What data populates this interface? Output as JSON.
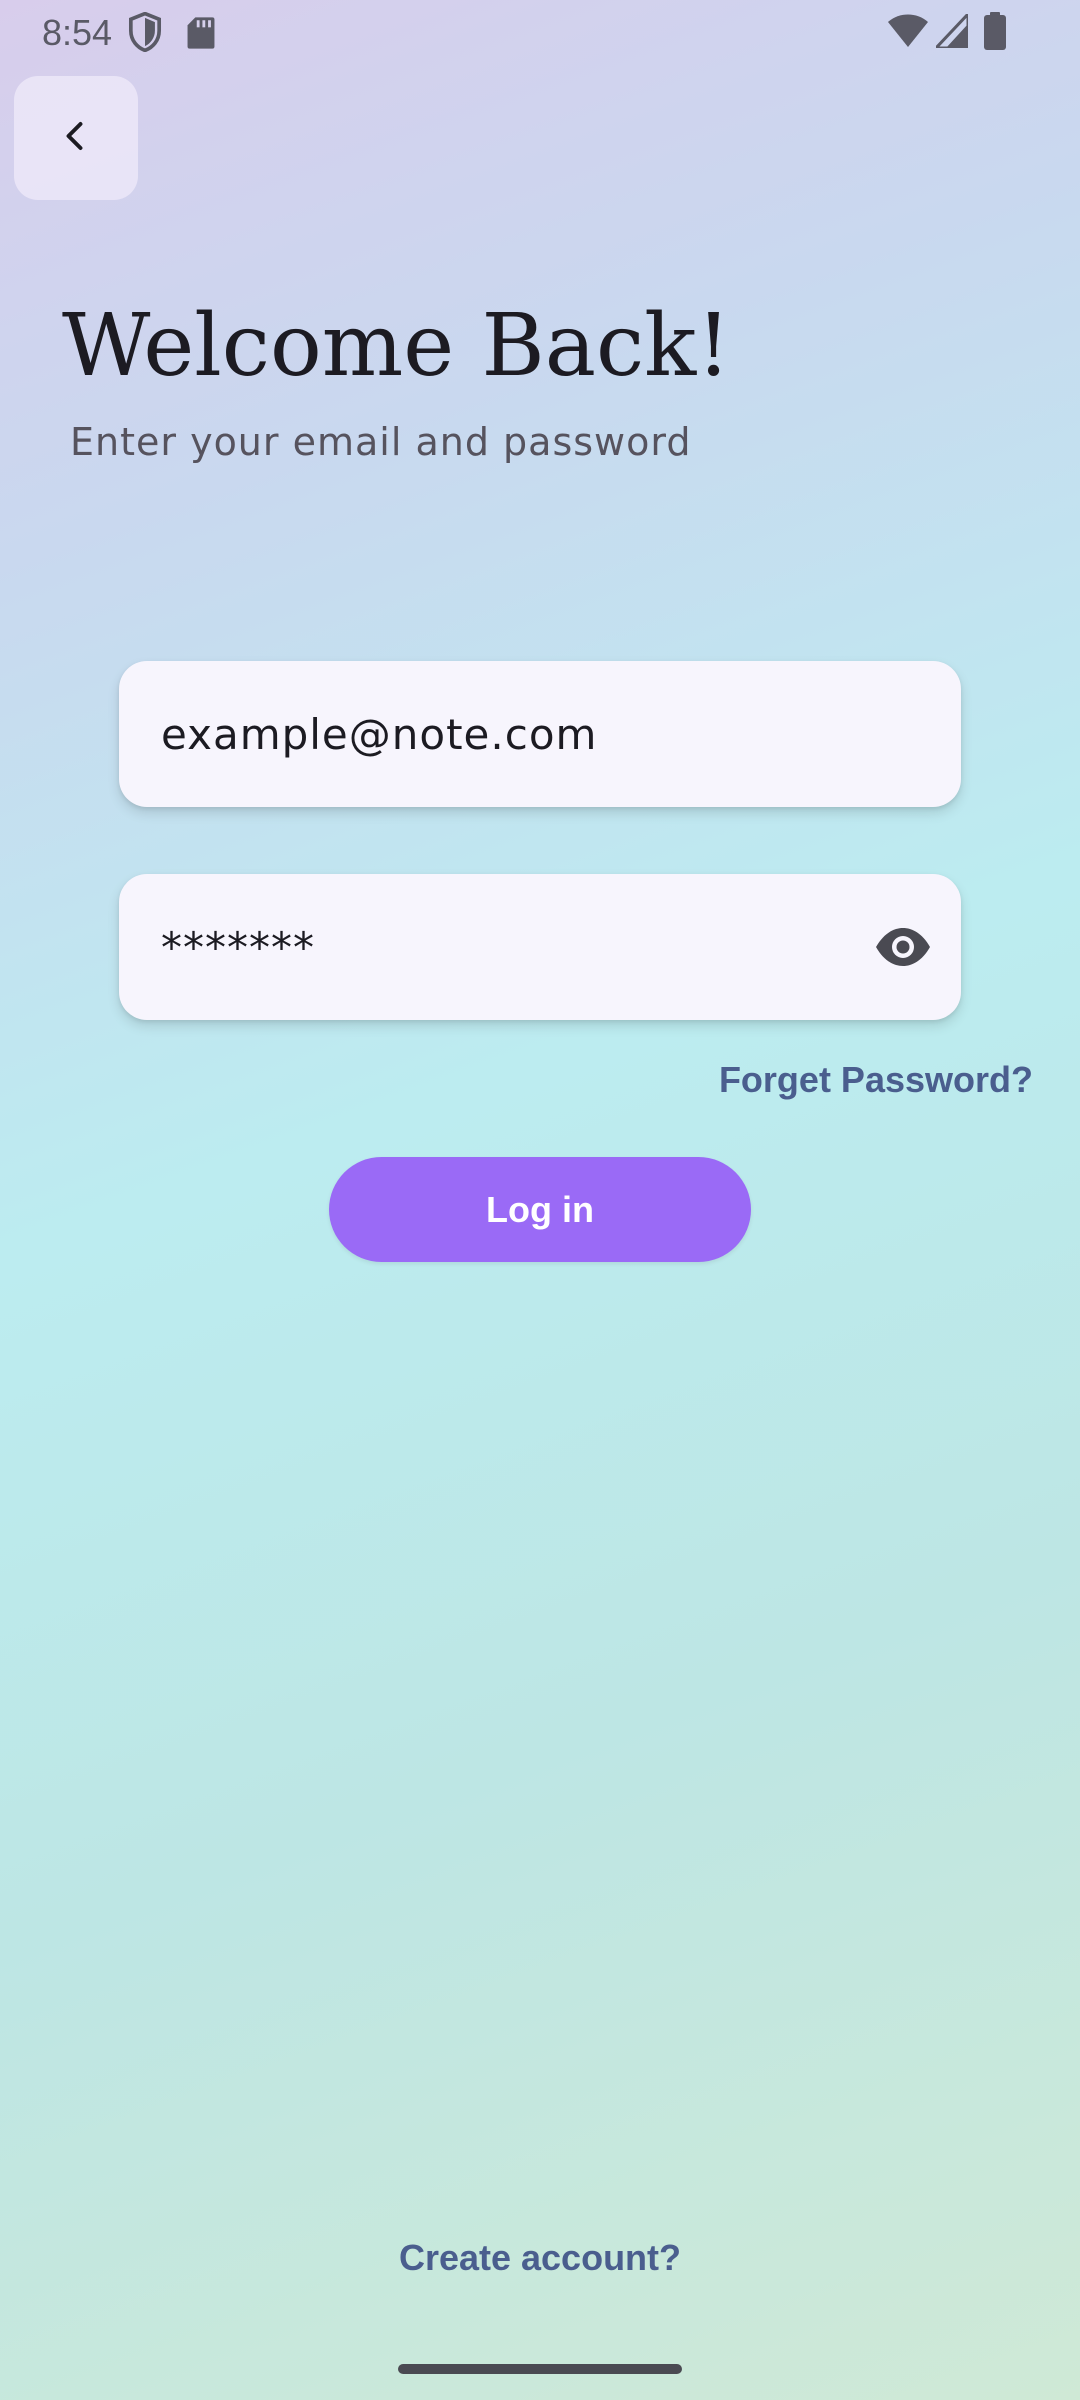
{
  "status_bar": {
    "time": "8:54",
    "left_icons": [
      "shield-icon",
      "sd-card-icon"
    ],
    "right_icons": [
      "wifi-icon",
      "cellular-signal-icon",
      "battery-icon"
    ]
  },
  "header": {
    "back_icon": "chevron-left-icon",
    "title": "Welcome Back!",
    "subtitle": "Enter your email and password"
  },
  "form": {
    "email_value": "example@note.com",
    "password_value": "*******",
    "password_toggle_icon": "eye-icon",
    "forgot_label": "Forget Password?",
    "login_label": "Log in"
  },
  "footer": {
    "create_account_label": "Create account?"
  },
  "colors": {
    "accent": "#9a6af6",
    "link": "#4a5e8e",
    "title": "#1c1b22",
    "field_bg": "#f7f5fd"
  }
}
